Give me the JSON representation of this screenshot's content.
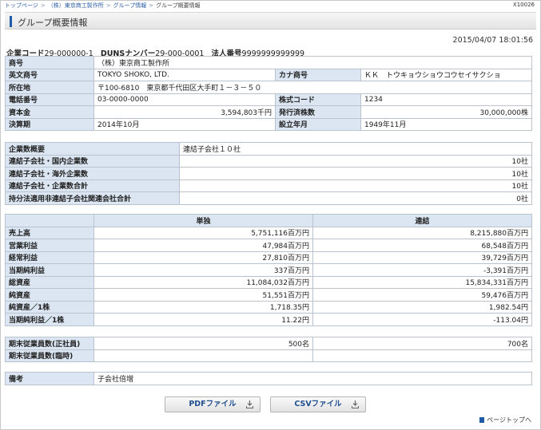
{
  "breadcrumb": {
    "items": [
      "トップページ",
      "（株）東京商工製作所",
      "グループ情報"
    ],
    "current": "グループ概要情報"
  },
  "page_id": "X10026",
  "page_title": "グループ概要情報",
  "timestamp": "2015/04/07 18:01:56",
  "codes": {
    "company_code_label": "企業コード",
    "company_code": "29-000000-1",
    "duns_label": "DUNSナンバー",
    "duns": "29-000-0001",
    "corp_no_label": "法人番号",
    "corp_no": "9999999999999"
  },
  "company": {
    "name_label": "商号",
    "name": "（株）東京商工製作所",
    "en_label": "英文商号",
    "en": "TOKYO SHOKO, LTD.",
    "kana_label": "カナ商号",
    "kana": "ＫＫ　トウキョウショウコウセイサクショ",
    "addr_label": "所在地",
    "addr": "〒100-6810　東京都千代田区大手町１－３－５０",
    "tel_label": "電話番号",
    "tel": "03-0000-0000",
    "stock_label": "株式コード",
    "stock": "1234",
    "capital_label": "資本金",
    "capital": "3,594,803千円",
    "shares_label": "発行済株数",
    "shares": "30,000,000株",
    "fy_label": "決算期",
    "fy": "2014年10月",
    "est_label": "設立年月",
    "est": "1949年11月"
  },
  "group": {
    "overview_label": "企業数概要",
    "overview": "連結子会社１０社",
    "rows": [
      {
        "label": "連結子会社・国内企業数",
        "value": "10社"
      },
      {
        "label": "連結子会社・海外企業数",
        "value": "10社"
      },
      {
        "label": "連結子会社・企業数合計",
        "value": "10社"
      },
      {
        "label": "持分法適用非連結子会社関連会社合計",
        "value": "0社"
      }
    ]
  },
  "financials": {
    "col_single": "単独",
    "col_consolidated": "連結",
    "rows": [
      {
        "label": "売上高",
        "single": "5,751,116百万円",
        "cons": "8,215,880百万円"
      },
      {
        "label": "営業利益",
        "single": "47,984百万円",
        "cons": "68,548百万円"
      },
      {
        "label": "経常利益",
        "single": "27,810百万円",
        "cons": "39,729百万円"
      },
      {
        "label": "当期純利益",
        "single": "337百万円",
        "cons": "-3,391百万円"
      },
      {
        "label": "総資産",
        "single": "11,084,032百万円",
        "cons": "15,834,331百万円"
      },
      {
        "label": "純資産",
        "single": "51,551百万円",
        "cons": "59,476百万円"
      },
      {
        "label": "純資産／1株",
        "single": "1,718.35円",
        "cons": "1,982.54円"
      },
      {
        "label": "当期純利益／1株",
        "single": "11.22円",
        "cons": "-113.04円"
      }
    ]
  },
  "employees": {
    "rows": [
      {
        "label": "期末従業員数(正社員)",
        "single": "500名",
        "cons": "700名"
      },
      {
        "label": "期末従業員数(臨時)",
        "single": "",
        "cons": ""
      }
    ]
  },
  "remarks": {
    "label": "備考",
    "value": "子会社倍増"
  },
  "buttons": {
    "pdf": "PDFファイル",
    "csv": "CSVファイル"
  },
  "page_top": "ページトップへ"
}
